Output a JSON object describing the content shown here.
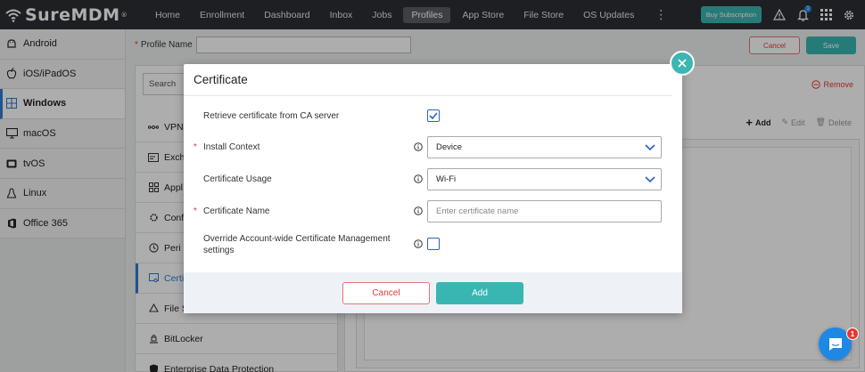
{
  "brand": {
    "name": "SureMDM",
    "mark": "®"
  },
  "nav": {
    "items": [
      {
        "label": "Home"
      },
      {
        "label": "Enrollment"
      },
      {
        "label": "Dashboard"
      },
      {
        "label": "Inbox"
      },
      {
        "label": "Jobs"
      },
      {
        "label": "Profiles",
        "active": true
      },
      {
        "label": "App Store"
      },
      {
        "label": "File Store"
      },
      {
        "label": "OS Updates"
      }
    ],
    "more": "⋮",
    "buy_label": "Buy Subscription",
    "notification_count": "1"
  },
  "sidebar": {
    "items": [
      {
        "label": "Android"
      },
      {
        "label": "iOS/iPadOS"
      },
      {
        "label": "Windows",
        "active": true
      },
      {
        "label": "macOS"
      },
      {
        "label": "tvOS"
      },
      {
        "label": "Linux"
      },
      {
        "label": "Office 365"
      }
    ]
  },
  "profile": {
    "name_label": "Profile Name",
    "cancel_label": "Cancel",
    "save_label": "Save"
  },
  "settings": {
    "search_placeholder": "Search",
    "items": [
      {
        "label": "VPN"
      },
      {
        "label": "Exch"
      },
      {
        "label": "Appl"
      },
      {
        "label": "Conf"
      },
      {
        "label": "Peri"
      },
      {
        "label": "Certi",
        "active": true
      },
      {
        "label": "File S"
      },
      {
        "label": "BitLocker"
      },
      {
        "label": "Enterprise Data Protection"
      }
    ]
  },
  "right_panel": {
    "remove_label": "Remove",
    "add_label": "Add",
    "edit_label": "Edit",
    "delete_label": "Delete"
  },
  "modal": {
    "title": "Certificate",
    "rows": {
      "retrieve": {
        "label": "Retrieve certificate from CA server",
        "checked": true
      },
      "install_context": {
        "label": "Install Context",
        "required": true,
        "value": "Device"
      },
      "usage": {
        "label": "Certificate Usage",
        "value": "Wi-Fi"
      },
      "cert_name": {
        "label": "Certificate Name",
        "required": true,
        "placeholder": "Enter certificate name"
      },
      "override": {
        "label": "Override Account-wide Certificate Management settings",
        "checked": false
      }
    },
    "cancel_label": "Cancel",
    "add_label": "Add"
  },
  "chat": {
    "badge": "1"
  },
  "colors": {
    "accent": "#39b6b1",
    "topbar": "#2b2f33",
    "danger": "#e53935",
    "link_blue": "#2e7dd1"
  }
}
